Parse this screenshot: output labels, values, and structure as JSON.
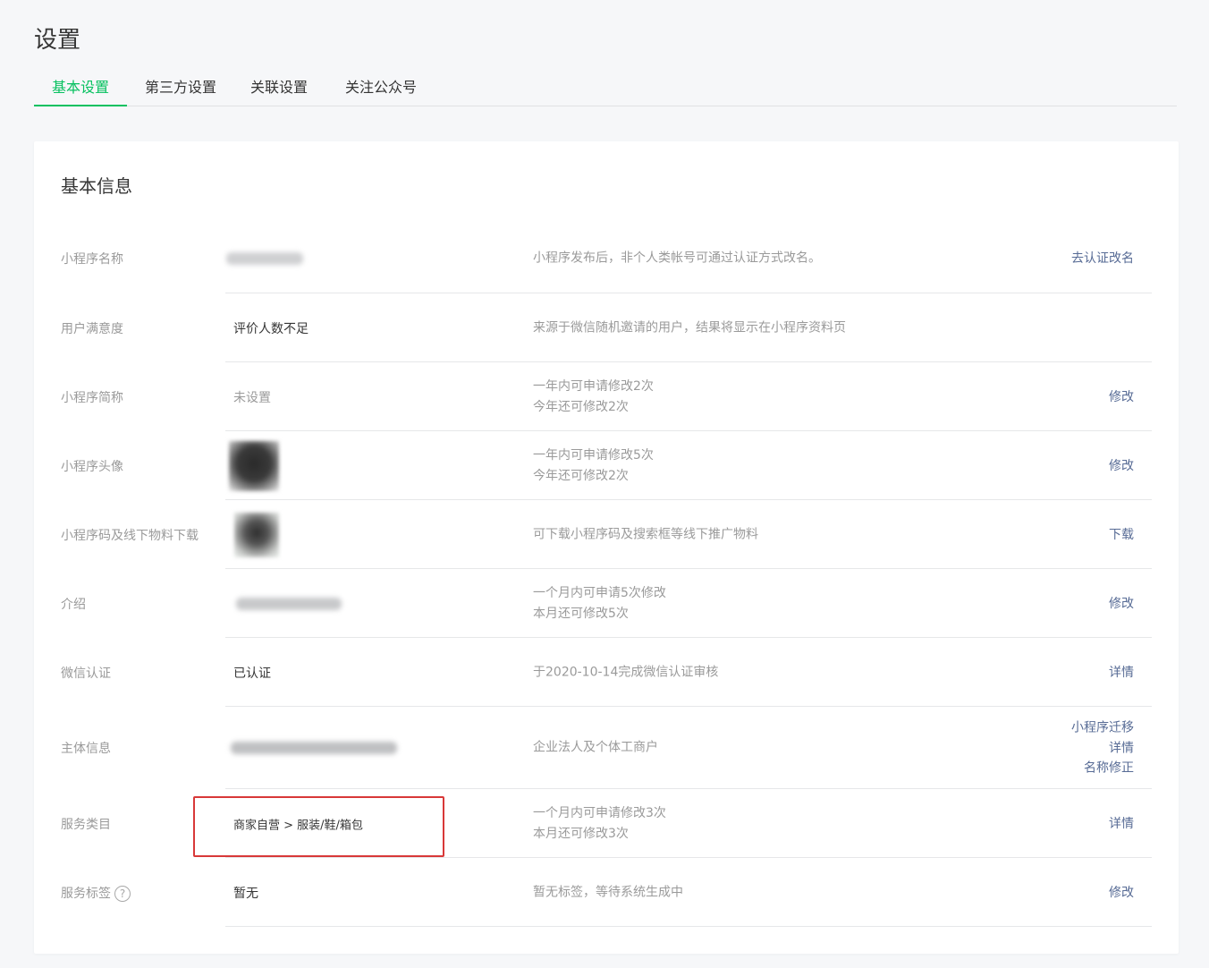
{
  "page": {
    "title": "设置"
  },
  "tabs": [
    {
      "label": "基本设置",
      "active": true
    },
    {
      "label": "第三方设置",
      "active": false
    },
    {
      "label": "关联设置",
      "active": false
    },
    {
      "label": "关注公众号",
      "active": false
    }
  ],
  "card": {
    "title": "基本信息"
  },
  "rows": {
    "name": {
      "label": "小程序名称",
      "desc": "小程序发布后，非个人类帐号可通过认证方式改名。",
      "action": "去认证改名"
    },
    "satisfaction": {
      "label": "用户满意度",
      "value": "评价人数不足",
      "desc": "来源于微信随机邀请的用户，结果将显示在小程序资料页"
    },
    "short_name": {
      "label": "小程序简称",
      "value": "未设置",
      "desc_line1": "一年内可申请修改2次",
      "desc_line2": "今年还可修改2次",
      "action": "修改"
    },
    "avatar": {
      "label": "小程序头像",
      "desc_line1": "一年内可申请修改5次",
      "desc_line2": "今年还可修改2次",
      "action": "修改"
    },
    "qrcode": {
      "label": "小程序码及线下物料下载",
      "desc": "可下载小程序码及搜索框等线下推广物料",
      "action": "下载"
    },
    "intro": {
      "label": "介绍",
      "desc_line1": "一个月内可申请5次修改",
      "desc_line2": "本月还可修改5次",
      "action": "修改"
    },
    "wechat_verify": {
      "label": "微信认证",
      "value": "已认证",
      "desc": "于2020-10-14完成微信认证审核",
      "action": "详情"
    },
    "entity": {
      "label": "主体信息",
      "desc": "企业法人及个体工商户",
      "actions": [
        "小程序迁移",
        "详情",
        "名称修正"
      ]
    },
    "category": {
      "label": "服务类目",
      "value": "商家自营 > 服装/鞋/箱包",
      "desc_line1": "一个月内可申请修改3次",
      "desc_line2": "本月还可修改3次",
      "action": "详情"
    },
    "tags": {
      "label": "服务标签",
      "help_glyph": "?",
      "value": "暂无",
      "desc": "暂无标签，等待系统生成中",
      "action": "修改"
    }
  },
  "colors": {
    "accent": "#07c160",
    "link": "#576b95",
    "highlight": "#d83838"
  }
}
